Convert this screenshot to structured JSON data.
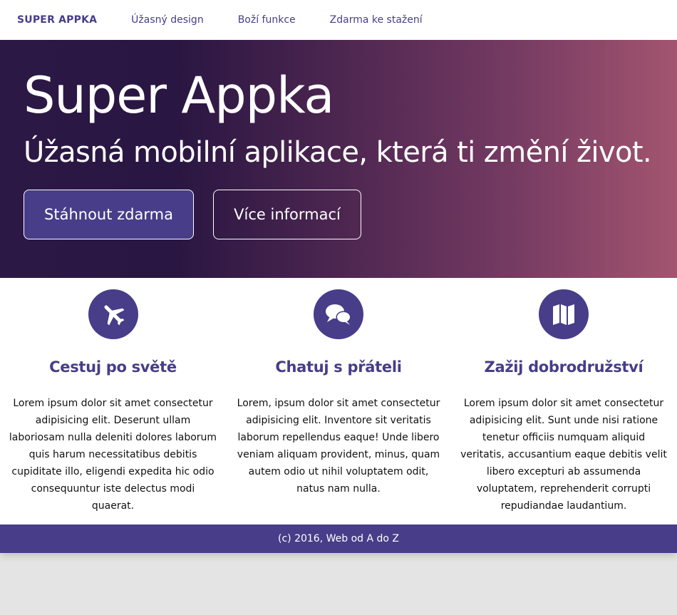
{
  "nav": {
    "brand": "SUPER APPKA",
    "links": [
      "Úžasný design",
      "Boží funkce",
      "Zdarma ke stažení"
    ]
  },
  "hero": {
    "title": "Super Appka",
    "subtitle": "Úžasná mobilní aplikace, která ti změní život.",
    "primary_button": "Stáhnout zdarma",
    "secondary_button": "Více informací"
  },
  "features": [
    {
      "icon": "airplane-icon",
      "title": "Cestuj po světě",
      "text": "Lorem ipsum dolor sit amet consectetur adipisicing elit. Deserunt ullam laboriosam nulla deleniti dolores laborum quis harum necessitatibus debitis cupiditate illo, eligendi expedita hic odio consequuntur iste delectus modi quaerat."
    },
    {
      "icon": "chat-bubbles-icon",
      "title": "Chatuj s přáteli",
      "text": "Lorem, ipsum dolor sit amet consectetur adipisicing elit. Inventore sit veritatis laborum repellendus eaque! Unde libero veniam aliquam provident, minus, quam autem odio ut nihil voluptatem odit, natus nam nulla."
    },
    {
      "icon": "map-icon",
      "title": "Zažij dobrodružství",
      "text": "Lorem ipsum dolor sit amet consectetur adipisicing elit. Sunt unde nisi ratione tenetur officiis numquam aliquid veritatis, accusantium eaque debitis velit libero excepturi ab assumenda voluptatem, reprehenderit corrupti repudiandae laudantium."
    }
  ],
  "footer": {
    "text": "(c) 2016, Web od A do Z"
  },
  "colors": {
    "accent": "#473d89",
    "background": "#e4e4e4"
  }
}
